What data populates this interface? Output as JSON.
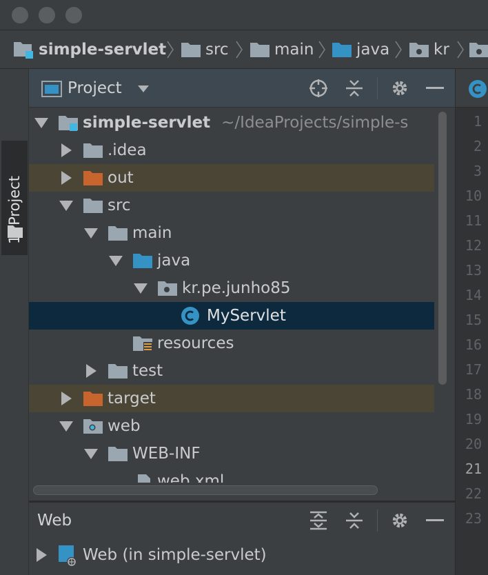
{
  "breadcrumb": {
    "items": [
      {
        "label": "simple-servlet",
        "icon": "module-folder-icon"
      },
      {
        "label": "src",
        "icon": "folder-icon"
      },
      {
        "label": "main",
        "icon": "folder-icon"
      },
      {
        "label": "java",
        "icon": "source-folder-icon"
      },
      {
        "label": "kr",
        "icon": "package-icon"
      },
      {
        "label": "",
        "icon": "package-icon"
      }
    ]
  },
  "toolwindow_strip": {
    "project_tab_label": "1: Project"
  },
  "project_panel": {
    "view_label": "Project",
    "tree": [
      {
        "label": "simple-servlet",
        "path": "~/IdeaProjects/simple-s",
        "icon": "module-folder-icon",
        "state": "expanded"
      },
      {
        "label": ".idea",
        "icon": "folder-icon",
        "state": "collapsed"
      },
      {
        "label": "out",
        "icon": "excluded-folder-icon",
        "state": "collapsed",
        "excluded": true
      },
      {
        "label": "src",
        "icon": "folder-icon",
        "state": "expanded"
      },
      {
        "label": "main",
        "icon": "folder-icon",
        "state": "expanded"
      },
      {
        "label": "java",
        "icon": "source-folder-icon",
        "state": "expanded"
      },
      {
        "label": "kr.pe.junho85",
        "icon": "package-icon",
        "state": "expanded"
      },
      {
        "label": "MyServlet",
        "icon": "java-class-icon",
        "state": "leaf",
        "selected": true
      },
      {
        "label": "resources",
        "icon": "resources-folder-icon",
        "state": "leaf"
      },
      {
        "label": "test",
        "icon": "folder-icon",
        "state": "collapsed"
      },
      {
        "label": "target",
        "icon": "excluded-folder-icon",
        "state": "collapsed",
        "excluded": true
      },
      {
        "label": "web",
        "icon": "web-folder-icon",
        "state": "expanded"
      },
      {
        "label": "WEB-INF",
        "icon": "folder-icon",
        "state": "expanded"
      },
      {
        "label": "web.xml",
        "icon": "xml-file-icon",
        "state": "leaf"
      }
    ]
  },
  "web_panel": {
    "title": "Web",
    "item_label": "Web (in simple-servlet)"
  },
  "editor": {
    "tab_icon": "java-class-icon",
    "line_numbers": [
      "1",
      "2",
      "3",
      "10",
      "11",
      "12",
      "13",
      "14",
      "15",
      "16",
      "17",
      "18",
      "19",
      "20",
      "21",
      "22",
      "23"
    ],
    "current_line": "21"
  },
  "colors": {
    "background": "#3c3f41",
    "selection": "#0d293e",
    "excluded_row": "#4b4535",
    "excluded_folder": "#c8642d",
    "source_folder": "#3592c4",
    "folder": "#9aa7b0"
  }
}
